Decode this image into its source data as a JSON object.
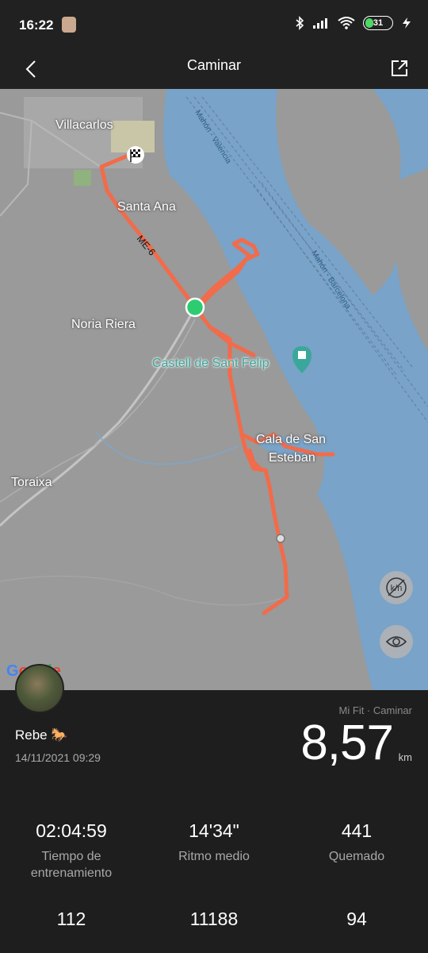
{
  "status": {
    "time": "16:22",
    "battery": "31"
  },
  "header": {
    "title": "Caminar"
  },
  "map": {
    "labels": {
      "villacarlos": "Villacarlos",
      "santa_ana": "Santa Ana",
      "me6": "ME-6",
      "noria_riera": "Noria Riera",
      "castell": "Castell de Sant Felip",
      "cala_line1": "Cala de San",
      "cala_line2": "Esteban",
      "toraixa": "Toraixa",
      "ferry1": "Mahón - Valencia",
      "ferry2": "Mahón - Barcelona"
    },
    "attribution": "Google",
    "colors": {
      "route": "#f26b4a",
      "water": "#79a3c8",
      "land": "#9a9a9a",
      "start": "#2ecc71"
    }
  },
  "summary": {
    "user_name": "Rebe 🐎",
    "datetime": "14/11/2021 09:29",
    "source": "Mi Fit · Caminar",
    "distance": "8,57",
    "distance_unit": "km"
  },
  "stats": [
    {
      "value": "02:04:59",
      "label": "Tiempo de entrenamiento"
    },
    {
      "value": "14'34\"",
      "label": "Ritmo medio"
    },
    {
      "value": "441",
      "label": "Quemado"
    },
    {
      "value": "112",
      "label": ""
    },
    {
      "value": "11188",
      "label": ""
    },
    {
      "value": "94",
      "label": ""
    }
  ]
}
